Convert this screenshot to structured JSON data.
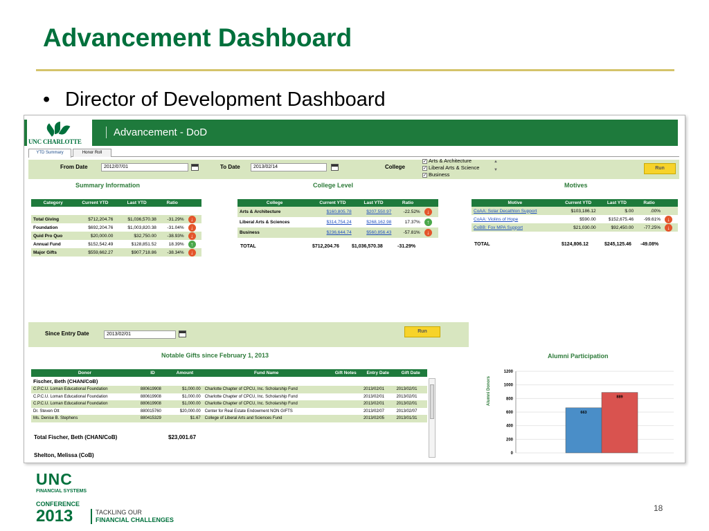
{
  "slide": {
    "title": "Advancement Dashboard",
    "bullet": "Director of Development Dashboard",
    "page_number": "18",
    "footer": {
      "unc": "UNC",
      "line1": "FINANCIAL SYSTEMS",
      "line2": "CONFERENCE",
      "year": "2013",
      "tag1": "TACKLING OUR",
      "tag2": "FINANCIAL CHALLENGES"
    },
    "colors": {
      "title_green": "#00703c",
      "rule_gold": "#d4c36a"
    }
  },
  "app": {
    "logo_text": "UNC CHARLOTTE",
    "title": "Advancement - DoD",
    "tabs": [
      "YTD Summary",
      "Honor Roll"
    ],
    "active_tab": "YTD Summary",
    "colors": {
      "header_green": "#1e7a3c",
      "band": "#d8e6c0",
      "run_button": "#f7d32a"
    }
  },
  "filters": {
    "from_date_label": "From Date",
    "from_date": "2012/07/01",
    "to_date_label": "To Date",
    "to_date": "2013/02/14",
    "college_label": "College",
    "colleges": [
      {
        "label": "Arts & Architecture",
        "checked": true
      },
      {
        "label": "Liberal Arts & Science",
        "checked": true
      },
      {
        "label": "Business",
        "checked": true
      }
    ],
    "run_label": "Run"
  },
  "summary": {
    "heading": "Summary Information",
    "headers": [
      "Category",
      "Current YTD",
      "Last YTD",
      "Ratio"
    ],
    "rows": [
      {
        "category": "Total Giving",
        "current": "$712,204.76",
        "last": "$1,036,570.38",
        "ratio": "-31.29%",
        "trend": "down"
      },
      {
        "category": "Foundation",
        "current": "$692,204.76",
        "last": "$1,003,820.38",
        "ratio": "-31.04%",
        "trend": "down"
      },
      {
        "category": "Quid Pro Quo",
        "current": "$20,000.00",
        "last": "$32,750.00",
        "ratio": "-38.93%",
        "trend": "down"
      },
      {
        "category": "Annual Fund",
        "current": "$152,542.49",
        "last": "$128,851.52",
        "ratio": "18.39%",
        "trend": "up"
      },
      {
        "category": "Major Gifts",
        "current": "$559,662.27",
        "last": "$907,718.86",
        "ratio": "-38.34%",
        "trend": "down"
      }
    ]
  },
  "college_level": {
    "heading": "College Level",
    "headers": [
      "College",
      "Current YTD",
      "Last YTD",
      "Ratio"
    ],
    "rows": [
      {
        "college": "Arts & Architecture",
        "current": "$160,805.78",
        "last": "$207,550.97",
        "ratio": "-22.52%",
        "trend": "down"
      },
      {
        "college": "Liberal Arts & Sciences",
        "current": "$314,754.24",
        "last": "$268,162.98",
        "ratio": "17.37%",
        "trend": "up"
      },
      {
        "college": "Business",
        "current": "$236,644.74",
        "last": "$560,856.43",
        "ratio": "-57.81%",
        "trend": "down"
      }
    ],
    "total": {
      "label": "TOTAL",
      "current": "$712,204.76",
      "last": "$1,036,570.38",
      "ratio": "-31.29%"
    }
  },
  "motives": {
    "heading": "Motives",
    "headers": [
      "Motive",
      "Current YTD",
      "Last YTD",
      "Ratio"
    ],
    "rows": [
      {
        "motive": "CoAA: Solar Decathlon Support",
        "current": "$103,186.12",
        "last": "$.00",
        "ratio": ".00%",
        "trend": ""
      },
      {
        "motive": "CoAA: Violins of Hope",
        "current": "$590.00",
        "last": "$152,675.46",
        "ratio": "-99.61%",
        "trend": "down"
      },
      {
        "motive": "CoBB: Fox MPA Support",
        "current": "$21,030.00",
        "last": "$92,450.00",
        "ratio": "-77.25%",
        "trend": "down"
      }
    ],
    "total": {
      "label": "TOTAL",
      "current": "$124,806.12",
      "last": "$245,125.46",
      "ratio": "-49.08%"
    }
  },
  "since_entry": {
    "label": "Since Entry Date",
    "value": "2013/02/01",
    "run_label": "Run"
  },
  "notable_gifts": {
    "heading": "Notable Gifts since February 1, 2013",
    "headers": [
      "Donor",
      "ID",
      "Amount",
      "Fund Name",
      "Gift Notes",
      "Entry Date",
      "Gift Date"
    ],
    "group_name": "Fischer, Beth (CHAN/CoB)",
    "rows": [
      {
        "donor": "C.P.C.U. Loman Educational Foundation",
        "id": "880619908",
        "amount": "$1,000.00",
        "fund": "Charlotte Chapter of CPCU, Inc. Scholarship Fund",
        "notes": "",
        "entry": "2013/02/01",
        "gift": "2013/02/01"
      },
      {
        "donor": "C.P.C.U. Loman Educational Foundation",
        "id": "880619908",
        "amount": "$1,000.00",
        "fund": "Charlotte Chapter of CPCU, Inc. Scholarship Fund",
        "notes": "",
        "entry": "2013/02/01",
        "gift": "2013/02/01"
      },
      {
        "donor": "C.P.C.U. Loman Educational Foundation",
        "id": "880619908",
        "amount": "$1,000.00",
        "fund": "Charlotte Chapter of CPCU, Inc. Scholarship Fund",
        "notes": "",
        "entry": "2013/02/01",
        "gift": "2013/02/01"
      },
      {
        "donor": "Dr. Steven Ott",
        "id": "880015760",
        "amount": "$20,000.00",
        "fund": "Center for Real Estate Endowment NON GIFTS",
        "notes": "",
        "entry": "2013/02/07",
        "gift": "2013/02/07"
      },
      {
        "donor": "Ms. Denise B. Stephens",
        "id": "880415329",
        "amount": "$1.67",
        "fund": "College of Liberal Arts and Sciences Fund",
        "notes": "",
        "entry": "2013/02/05",
        "gift": "2013/01/31"
      }
    ],
    "total_label": "Total Fischer, Beth (CHAN/CoB)",
    "total_amount": "$23,001.67",
    "next_group": "Shelton, Melissa (CoB)"
  },
  "chart_data": {
    "type": "bar",
    "title": "Alumni Participation",
    "ylabel": "Alumni Donors",
    "xlabel": "",
    "categories": [
      "",
      ""
    ],
    "values": [
      663,
      889
    ],
    "data_labels": [
      "663",
      "889"
    ],
    "colors": [
      "#4a8ec8",
      "#d9534f"
    ],
    "ylim": [
      0,
      1200
    ],
    "yticks": [
      0,
      200,
      400,
      600,
      800,
      1000,
      1200
    ],
    "grid": true
  }
}
